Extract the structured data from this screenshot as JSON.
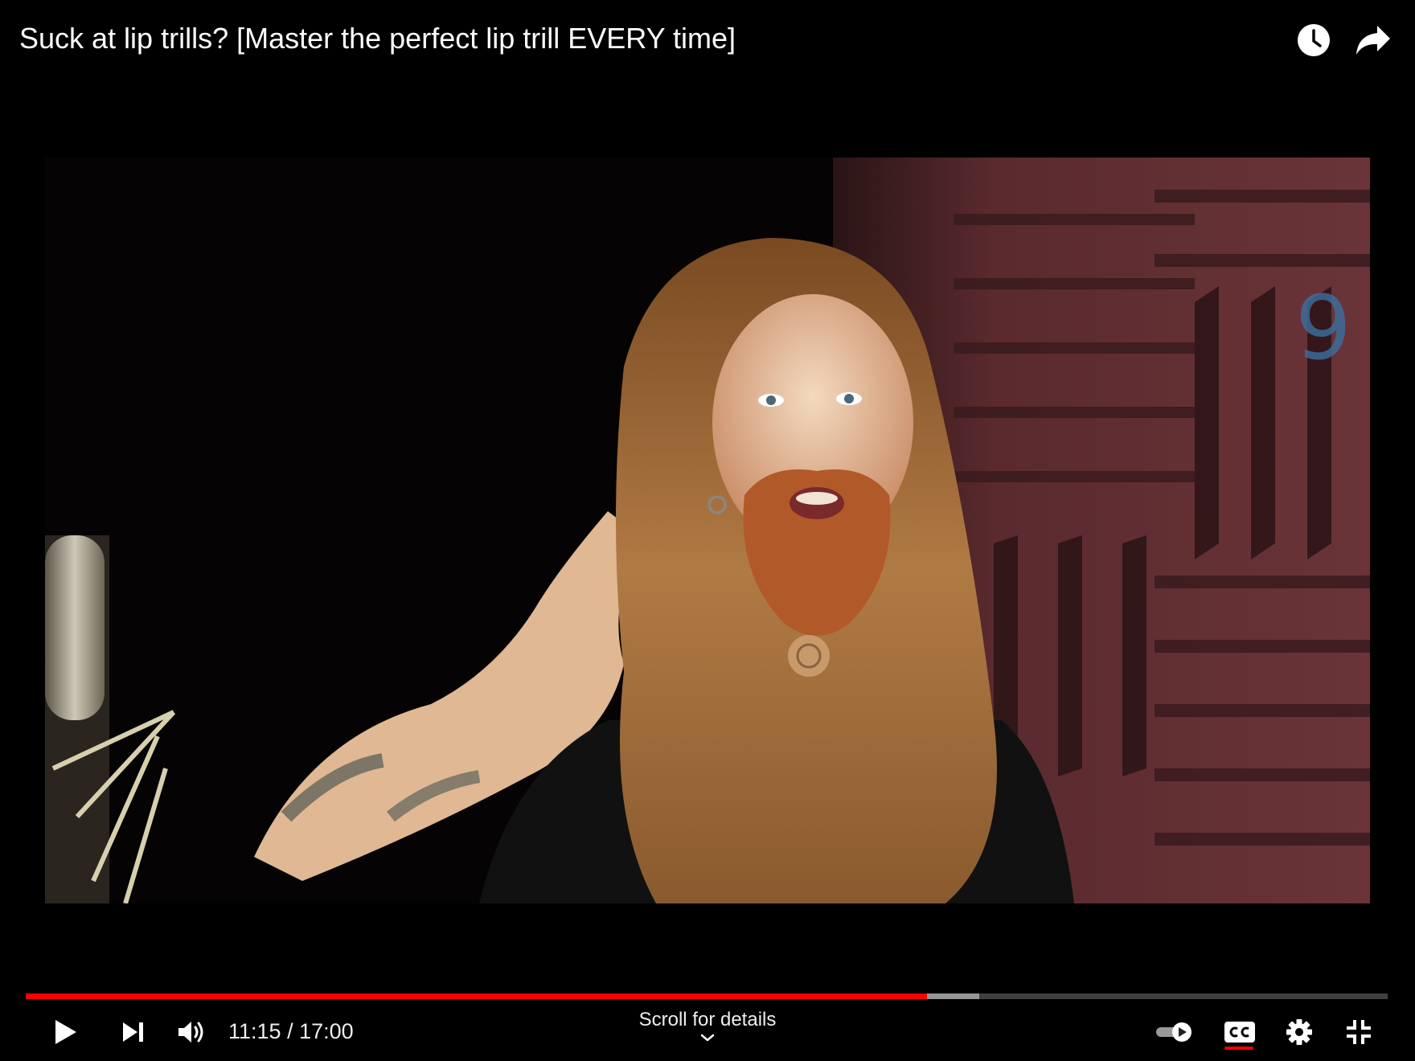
{
  "video": {
    "title": "Suck at lip trills? [Master the perfect lip trill EVERY time]",
    "current_time": "11:15",
    "duration": "17:00",
    "time_display": "11:15 / 17:00",
    "played_fraction": 0.662,
    "buffered_fraction": 0.7
  },
  "top_actions": [
    {
      "name": "watch-later",
      "icon": "clock-icon"
    },
    {
      "name": "share",
      "icon": "share-arrow-icon"
    }
  ],
  "controls": {
    "play_icon": "play-icon",
    "next_icon": "skip-next-icon",
    "volume_icon": "volume-icon",
    "autoplay_icon": "autoplay-toggle-icon",
    "captions_icon": "cc-icon",
    "captions_enabled": true,
    "settings_icon": "gear-icon",
    "fullscreen_icon": "exit-fullscreen-icon",
    "scroll_label": "Scroll for details",
    "scroll_icon": "chevron-down-icon"
  },
  "colors": {
    "progress_played": "#ff0000",
    "background": "#000000",
    "foam": "#5a2a2e"
  }
}
